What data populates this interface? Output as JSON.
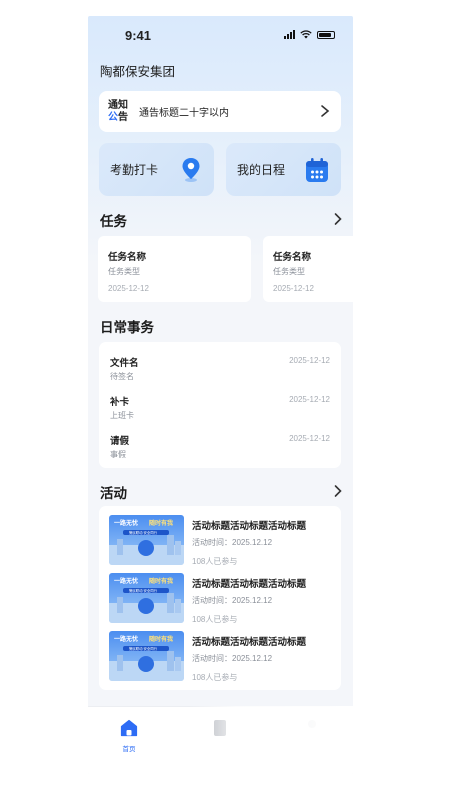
{
  "status_bar": {
    "time": "9:41"
  },
  "header": {
    "company": "陶都保安集团"
  },
  "notice": {
    "tag_line1": "通知",
    "tag_line2a": "公",
    "tag_line2b": "告",
    "title": "通告标题二十字以内"
  },
  "quick": {
    "attendance": "考勤打卡",
    "schedule": "我的日程"
  },
  "tasks": {
    "title": "任务",
    "items": [
      {
        "name": "任务名称",
        "type": "任务类型",
        "date": "2025-12-12"
      },
      {
        "name": "任务名称",
        "type": "任务类型",
        "date": "2025-12-12"
      }
    ]
  },
  "daily": {
    "title": "日常事务",
    "items": [
      {
        "name": "文件名",
        "sub": "待签名",
        "date": "2025-12-12"
      },
      {
        "name": "补卡",
        "sub": "上班卡",
        "date": "2025-12-12"
      },
      {
        "name": "请假",
        "sub": "事假",
        "date": "2025-12-12"
      }
    ]
  },
  "activities": {
    "title": "活动",
    "items": [
      {
        "title": "活动标题活动标题活动标题",
        "time": "活动时间：2025.12.12",
        "count": "108人已参与",
        "banner_main": "一路无忧",
        "banner_right": "随时有我",
        "banner_sub": "警民联动 安全同行"
      },
      {
        "title": "活动标题活动标题活动标题",
        "time": "活动时间：2025.12.12",
        "count": "108人已参与",
        "banner_main": "一路无忧",
        "banner_right": "随时有我",
        "banner_sub": "警民联动 安全同行"
      },
      {
        "title": "活动标题活动标题活动标题",
        "time": "活动时间：2025.12.12",
        "count": "108人已参与",
        "banner_main": "一路无忧",
        "banner_right": "随时有我",
        "banner_sub": "警民联动 安全同行"
      }
    ]
  },
  "tabbar": {
    "home": "首页",
    "accent": "#2d6cf5"
  }
}
